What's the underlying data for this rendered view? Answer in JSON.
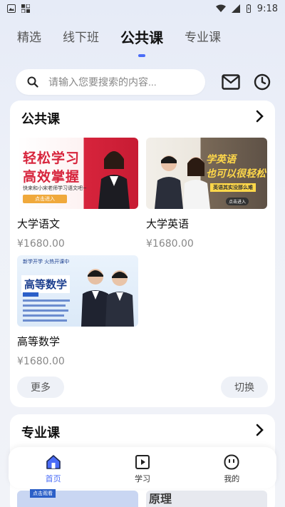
{
  "status_bar": {
    "time": "9:18"
  },
  "tabs": [
    {
      "label": "精选"
    },
    {
      "label": "线下班"
    },
    {
      "label": "公共课"
    },
    {
      "label": "专业课"
    }
  ],
  "search": {
    "placeholder": "请输入您要搜索的内容..."
  },
  "section_public": {
    "title": "公共课",
    "courses": [
      {
        "name": "大学语文",
        "price": "¥1680.00",
        "thumb_title_1": "轻松学习",
        "thumb_title_2": "高效掌握",
        "thumb_caption": "快来和小宋老师学习语文吧~",
        "thumb_button": "点击进入"
      },
      {
        "name": "大学英语",
        "price": "¥1680.00",
        "thumb_title_1": "学英语",
        "thumb_title_2": "也可以很轻松",
        "thumb_caption": "英语其实没那么难",
        "thumb_button": "点击进入"
      },
      {
        "name": "高等数学",
        "price": "¥1680.00",
        "thumb_banner": "高等数学",
        "thumb_top": "新学开学 火热开课中"
      }
    ],
    "more_label": "更多",
    "switch_label": "切换"
  },
  "section_major": {
    "title": "专业课",
    "peek_text": "原理",
    "peek_button": "点击观看"
  },
  "bottom_nav": [
    {
      "label": "首页",
      "icon": "home-icon"
    },
    {
      "label": "学习",
      "icon": "play-icon"
    },
    {
      "label": "我的",
      "icon": "face-icon"
    }
  ],
  "colors": {
    "accent": "#4a6cf7",
    "red_thumb": "#d7243c",
    "english_thumb": "#7a6a58"
  }
}
